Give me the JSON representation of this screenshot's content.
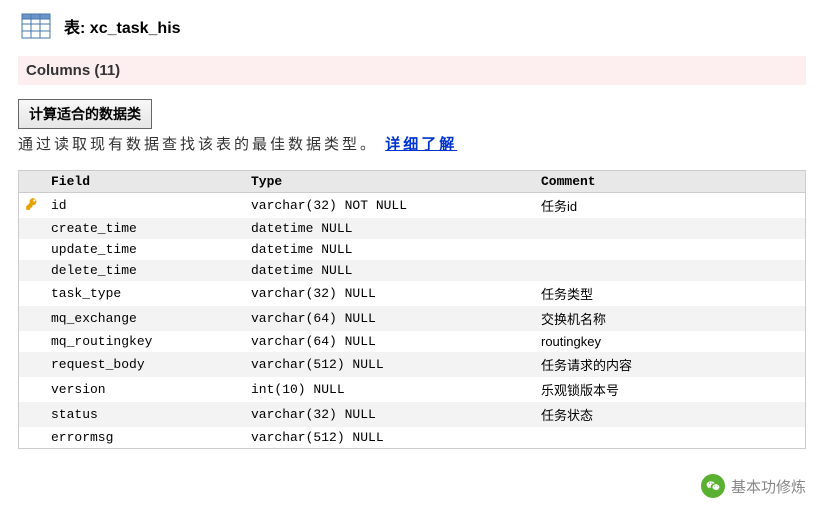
{
  "header": {
    "title_prefix": "表:",
    "table_name": "xc_task_his"
  },
  "columns_section": {
    "label": "Columns (11)"
  },
  "toolbar": {
    "calc_button_label": "计算适合的数据类",
    "hint_text": "通过读取现有数据查找该表的最佳数据类型。",
    "learn_more_label": "详细了解"
  },
  "table": {
    "headers": {
      "field": "Field",
      "type": "Type",
      "comment": "Comment"
    },
    "rows": [
      {
        "pk": true,
        "field": "id",
        "type": "varchar(32) NOT NULL",
        "comment": "任务id"
      },
      {
        "pk": false,
        "field": "create_time",
        "type": "datetime NULL",
        "comment": ""
      },
      {
        "pk": false,
        "field": "update_time",
        "type": "datetime NULL",
        "comment": ""
      },
      {
        "pk": false,
        "field": "delete_time",
        "type": "datetime NULL",
        "comment": ""
      },
      {
        "pk": false,
        "field": "task_type",
        "type": "varchar(32) NULL",
        "comment": "任务类型"
      },
      {
        "pk": false,
        "field": "mq_exchange",
        "type": "varchar(64) NULL",
        "comment": "交换机名称"
      },
      {
        "pk": false,
        "field": "mq_routingkey",
        "type": "varchar(64) NULL",
        "comment": "routingkey"
      },
      {
        "pk": false,
        "field": "request_body",
        "type": "varchar(512) NULL",
        "comment": "任务请求的内容"
      },
      {
        "pk": false,
        "field": "version",
        "type": "int(10) NULL",
        "comment": "乐观锁版本号"
      },
      {
        "pk": false,
        "field": "status",
        "type": "varchar(32) NULL",
        "comment": "任务状态"
      },
      {
        "pk": false,
        "field": "errormsg",
        "type": "varchar(512) NULL",
        "comment": ""
      }
    ]
  },
  "watermark": {
    "text": "基本功修炼"
  }
}
